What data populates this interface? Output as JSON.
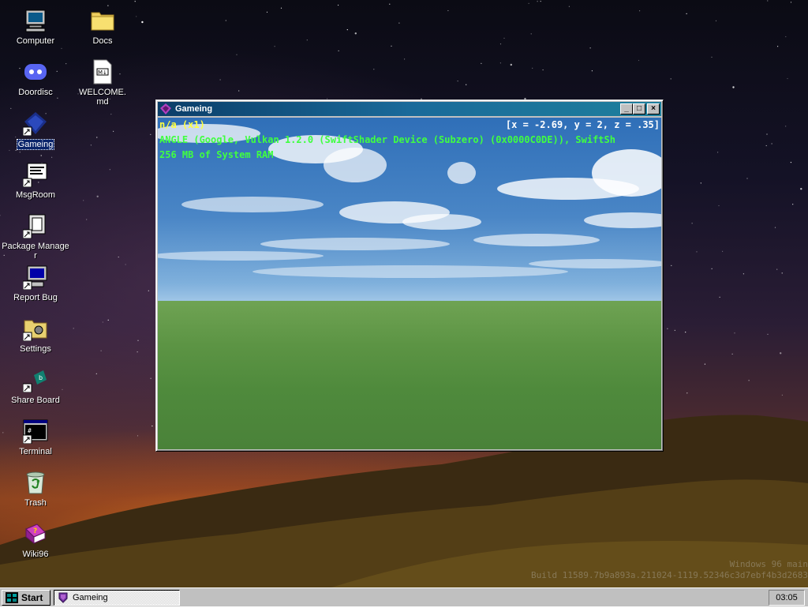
{
  "desktop": {
    "icons": [
      {
        "label": "Computer",
        "icon": "computer-icon"
      },
      {
        "label": "Docs",
        "icon": "folder-icon"
      },
      {
        "label": "Doordisc",
        "icon": "discord-icon"
      },
      {
        "label": "WELCOME.md",
        "icon": "markdown-file-icon"
      },
      {
        "label": "Gameing",
        "icon": "game-icon"
      },
      {
        "label": "MsgRoom",
        "icon": "chat-icon"
      },
      {
        "label": "Package Manager",
        "icon": "package-icon"
      },
      {
        "label": "Report Bug",
        "icon": "bug-report-icon"
      },
      {
        "label": "Settings",
        "icon": "settings-icon"
      },
      {
        "label": "Share Board",
        "icon": "share-board-icon"
      },
      {
        "label": "Terminal",
        "icon": "terminal-icon"
      },
      {
        "label": "Trash",
        "icon": "trash-icon"
      },
      {
        "label": "Wiki96",
        "icon": "wiki-icon"
      }
    ],
    "watermark": {
      "line1": "Windows 96 main",
      "line2": "Build 11589.7b9a893a.211024-1119.52346c3d7ebf4b3d2683"
    }
  },
  "window": {
    "title": "Gameing",
    "buttons": {
      "minimize": "_",
      "maximize": "□",
      "close": "×"
    },
    "hud": {
      "mode": "n/a (x1)",
      "coords": "[x = -2.69, y = 2, z = .35]",
      "renderer": "ANGLE (Google, Vulkan 1.2.0 (SwiftShader Device (Subzero) (0x0000C0DE)), SwiftSh",
      "memory": "256 MB of System RAM"
    },
    "colors": {
      "hud_yellow": "#ffff40",
      "hud_green": "#40ff40",
      "hud_cyan": "#40ffff"
    }
  },
  "taskbar": {
    "start_label": "Start",
    "task_label": "Gameing",
    "clock": "03:05"
  }
}
